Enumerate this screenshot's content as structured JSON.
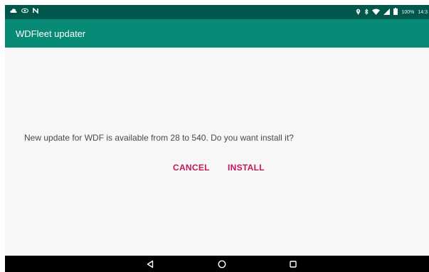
{
  "status_bar": {
    "left_icons": [
      "cloud-icon",
      "eye-icon",
      "n-notification-icon"
    ],
    "right_icons": [
      "location-icon",
      "bluetooth-icon",
      "wifi-icon",
      "signal-icon",
      "battery-icon"
    ],
    "battery_percent": "100%",
    "time": "14:3"
  },
  "app_bar": {
    "title": "WDFleet updater"
  },
  "dialog": {
    "message": "New update for WDF is available from 28 to 540. Do you want install it?",
    "cancel_label": "CANCEL",
    "install_label": "INSTALL"
  },
  "nav_bar": {
    "buttons": [
      "back-icon",
      "home-icon",
      "recents-icon"
    ]
  },
  "colors": {
    "status_bar_bg": "#00574b",
    "app_bar_bg": "#078a76",
    "dialog_button_color": "#c2185b",
    "nav_bar_bg": "#000000"
  }
}
